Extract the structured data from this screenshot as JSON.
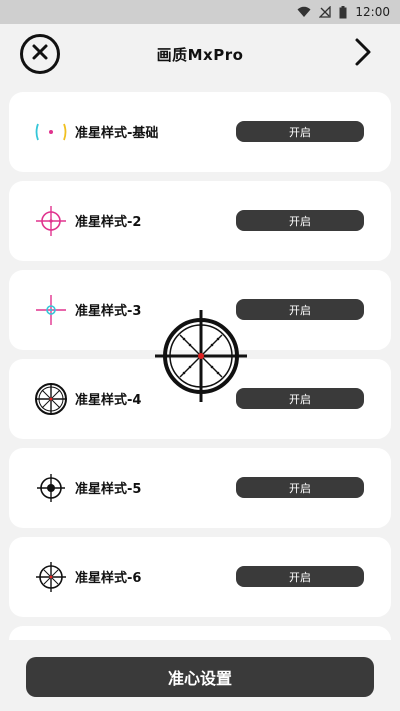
{
  "status_bar": {
    "time": "12:00",
    "icons": [
      "wifi-icon",
      "signal-icon",
      "battery-icon"
    ]
  },
  "header": {
    "title": "画质MxPro",
    "close_icon": "close-icon",
    "next_icon": "chevron-right-icon"
  },
  "items": [
    {
      "label": "准星样式-基础",
      "button": "开启",
      "icon": "crosshair-basic-icon"
    },
    {
      "label": "准星样式-2",
      "button": "开启",
      "icon": "crosshair-pink-icon"
    },
    {
      "label": "准星样式-3",
      "button": "开启",
      "icon": "crosshair-pink-cyan-icon"
    },
    {
      "label": "准星样式-4",
      "button": "开启",
      "icon": "crosshair-circle-x-icon"
    },
    {
      "label": "准星样式-5",
      "button": "开启",
      "icon": "crosshair-scope-dot-icon"
    },
    {
      "label": "准星样式-6",
      "button": "开启",
      "icon": "crosshair-scope-x-icon"
    }
  ],
  "overlay_icon": "crosshair-preview-icon",
  "bottom_button": {
    "label": "准心设置"
  },
  "colors": {
    "button_bg": "#3a3a3a",
    "page_bg": "#f2f2f2",
    "accent_pink": "#e0338e",
    "accent_cyan": "#35c6d8"
  }
}
